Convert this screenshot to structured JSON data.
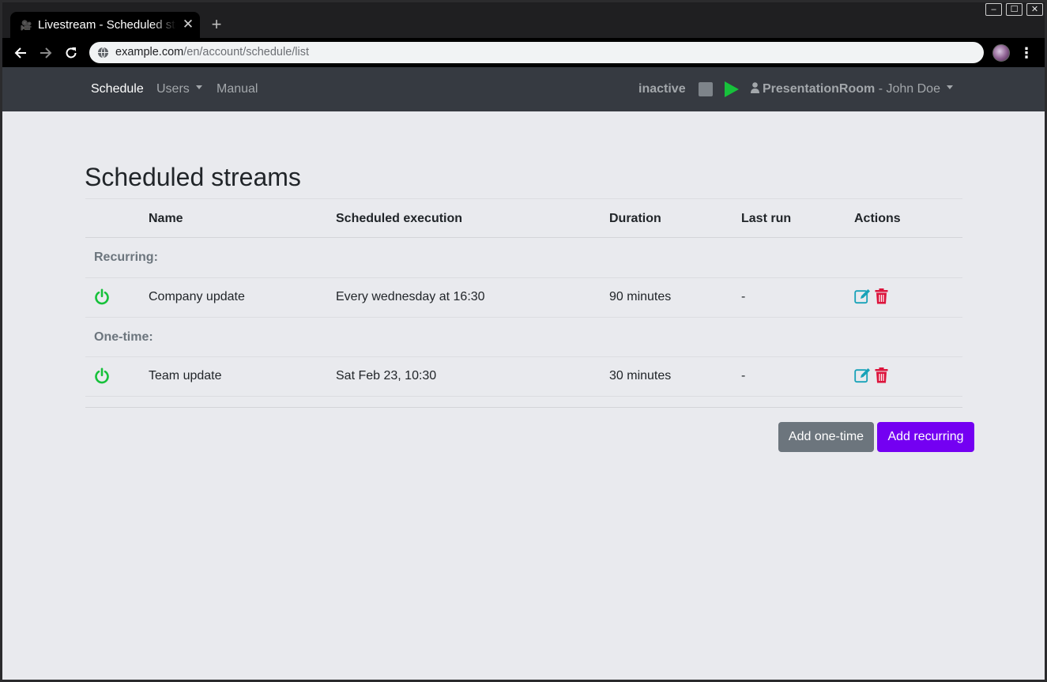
{
  "browser": {
    "tab_title": "Livestream - Scheduled streams",
    "tab_close_glyph": "✕",
    "new_tab_glyph": "+",
    "url_host": "example.com",
    "url_path": "/en/account/schedule/list",
    "window_controls": {
      "minimize": "–",
      "maximize": "☐",
      "close": "✕"
    }
  },
  "navbar": {
    "links": [
      {
        "label": "Schedule"
      },
      {
        "label": "Users"
      },
      {
        "label": "Manual"
      }
    ],
    "status": "inactive",
    "room": "PresentationRoom",
    "user": " - John Doe"
  },
  "page": {
    "title": "Scheduled streams",
    "columns": {
      "name": "Name",
      "execution": "Scheduled execution",
      "duration": "Duration",
      "last_run": "Last run",
      "actions": "Actions"
    },
    "groups": [
      {
        "label": "Recurring:",
        "items": [
          {
            "name": "Company update",
            "execution": "Every wednesday at 16:30",
            "duration": "90 minutes",
            "last_run": "-"
          }
        ]
      },
      {
        "label": "One-time:",
        "items": [
          {
            "name": "Team update",
            "execution": "Sat Feb 23, 10:30",
            "duration": "30 minutes",
            "last_run": "-"
          }
        ]
      }
    ],
    "buttons": {
      "add_one_time": "Add one-time",
      "add_recurring": "Add recurring"
    }
  },
  "colors": {
    "navbar_bg": "#363a41",
    "power_on": "#17c13b",
    "edit": "#17a2b8",
    "delete": "#dc143c",
    "primary": "#7400f2",
    "secondary": "#6c757d"
  }
}
